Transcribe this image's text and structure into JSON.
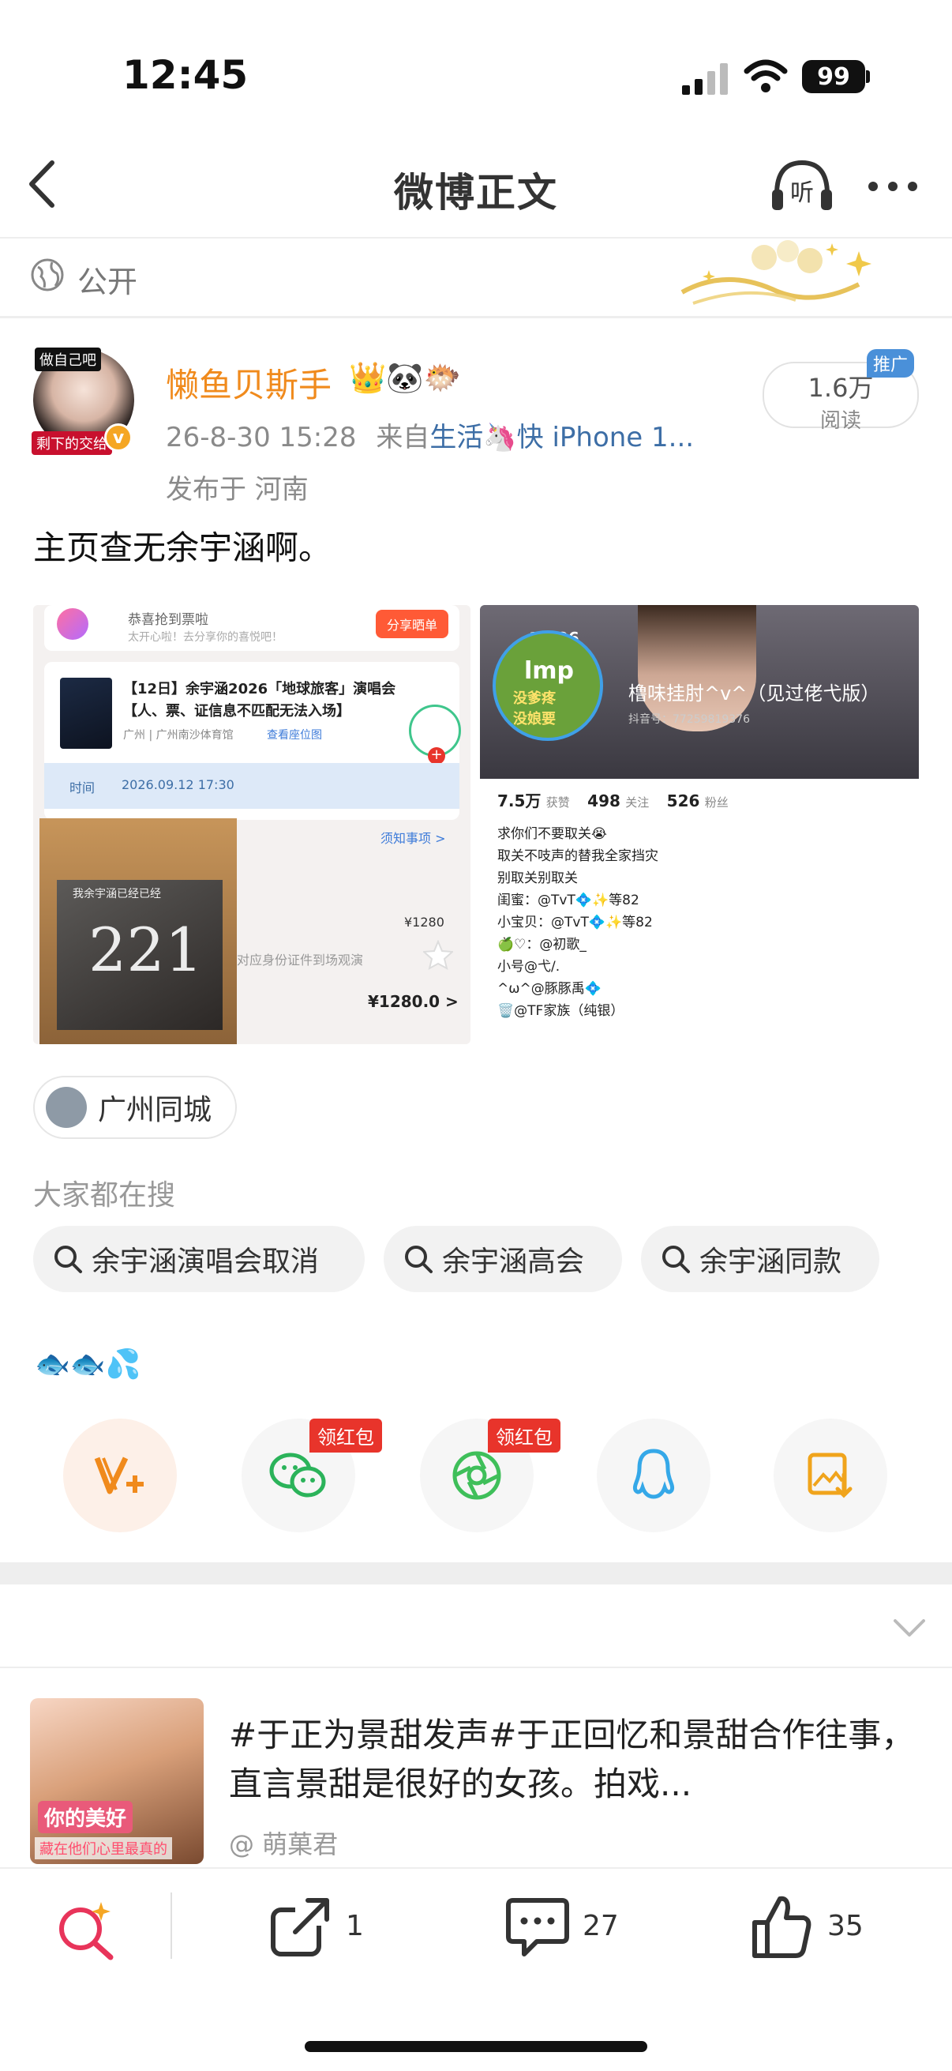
{
  "status_bar": {
    "time": "12:45",
    "battery": "99"
  },
  "nav": {
    "title": "微博正文",
    "listen_label": "听"
  },
  "visibility": {
    "label": "公开"
  },
  "post": {
    "avatar_tag_top": "做自己吧",
    "avatar_tag_bottom": "剩下的交给",
    "username": "懒鱼贝斯手",
    "user_badges": "👑🐼🐡",
    "timestamp": "26-8-30 15:28",
    "source_prefix": "来自",
    "source": "生活🦄快 iPhone 1...",
    "location": "发布于 河南",
    "read_count": "1.6万",
    "read_label": "阅读",
    "promo_tag": "推广",
    "text": "主页查无余宇涵啊。"
  },
  "image1": {
    "banner_text": "恭喜抢到票啦",
    "banner_sub": "太开心啦！去分享你的喜悦吧！",
    "share_button": "分享晒单",
    "ticket_title": "【12日】余宇涵2026「地球旅客」演唱会",
    "ticket_sub": "【人、票、证信息不匹配无法入场】",
    "venue": "广州 | 广州南沙体育馆",
    "seat_link": "查看座位图",
    "time_label": "时间",
    "time_value": "2026.09.12 17:30",
    "notice": "须知事项 >",
    "price1": "¥1280",
    "id_note": "对应身份证件到场观演",
    "price2": "¥1280.0 >",
    "photo_number": "221",
    "photo_caption": "我余宇涵已经已经"
  },
  "image2": {
    "time": "15:26",
    "profile_name": "橹味挂肘^v^（见过佬弋版）",
    "douyin_id": "抖音号：77259819376",
    "likes": "7.5万",
    "likes_label": "获赞",
    "following": "498",
    "following_label": "关注",
    "followers": "526",
    "followers_label": "粉丝",
    "bio_lines": [
      "求你们不要取关😭",
      "取关不吱声的替我全家挡灾",
      "别取关别取关",
      "闺蜜：@TvT💠✨等82",
      "小宝贝：@TvT💠✨等82",
      "🍏♡：@初歌_",
      "小号@弋/.",
      "^ω^@豚豚禹💠",
      "🗑️@TF家族（纯银）"
    ],
    "sticker_line1": "lmp",
    "sticker_line2": "没爹疼",
    "sticker_line3": "没娘要"
  },
  "location_chip": {
    "label": "广州同城"
  },
  "searching": {
    "title": "大家都在搜",
    "chips": [
      "余宇涵演唱会取消",
      "余宇涵高会",
      "余宇涵同款"
    ]
  },
  "emoji_line": "🐟🐟💦",
  "share": {
    "red_packet_label": "领红包",
    "targets": [
      "vplus-icon",
      "wechat-icon",
      "moments-icon",
      "qq-icon",
      "save-image-icon"
    ]
  },
  "recommendation": {
    "title": "#于正为景甜发声#于正回忆和景甜合作往事，直言景甜是很好的女孩。拍戏...",
    "author": "@ 萌菓君",
    "thumb_caption1": "你的美好",
    "thumb_caption2": "藏在他们心里最真的"
  },
  "bottom_bar": {
    "repost_count": "1",
    "comment_count": "27",
    "like_count": "35"
  },
  "colors": {
    "username": "#f08a1c",
    "link": "#3d6ea6",
    "red_tag": "#e8342b",
    "verify": "#f5a623"
  }
}
